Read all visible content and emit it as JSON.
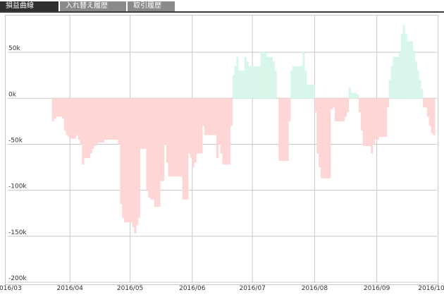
{
  "tabs": [
    {
      "label": "損益曲線",
      "active": true
    },
    {
      "label": "入れ替え履歴",
      "active": false
    },
    {
      "label": "取引履歴",
      "active": false
    }
  ],
  "colors": {
    "positive_fill": "#d8f7ea",
    "negative_fill": "#ffd6d6",
    "grid": "#c8c8c8",
    "tab_active": "#303030",
    "tab_inactive": "#8a8a8a"
  },
  "chart_data": {
    "type": "area",
    "title": "",
    "xlabel": "",
    "ylabel": "",
    "grid": true,
    "x_ticks": [
      "2016/03",
      "2016/04",
      "2016/05",
      "2016/06",
      "2016/07",
      "2016/08",
      "2016/09",
      "2016/10"
    ],
    "y_ticks": [
      {
        "value": 50000,
        "label": "50k"
      },
      {
        "value": 0,
        "label": "0k"
      },
      {
        "value": -50000,
        "label": "-50k"
      },
      {
        "value": -100000,
        "label": "-100k"
      },
      {
        "value": -150000,
        "label": "-150k"
      },
      {
        "value": -200000,
        "label": "-200k"
      }
    ],
    "ylim": [
      -200000,
      90000
    ],
    "xlim": [
      "2016-03-01",
      "2016-10-01"
    ],
    "points": [
      [
        "2016-03-22",
        0
      ],
      [
        "2016-03-23",
        -25000
      ],
      [
        "2016-03-24",
        -22000
      ],
      [
        "2016-03-25",
        -20000
      ],
      [
        "2016-03-28",
        -22000
      ],
      [
        "2016-03-29",
        -35000
      ],
      [
        "2016-03-30",
        -40000
      ],
      [
        "2016-03-31",
        -42000
      ],
      [
        "2016-04-01",
        -44000
      ],
      [
        "2016-04-04",
        -40000
      ],
      [
        "2016-04-05",
        -45000
      ],
      [
        "2016-04-06",
        -50000
      ],
      [
        "2016-04-07",
        -72000
      ],
      [
        "2016-04-08",
        -65000
      ],
      [
        "2016-04-11",
        -60000
      ],
      [
        "2016-04-12",
        -55000
      ],
      [
        "2016-04-13",
        -52000
      ],
      [
        "2016-04-14",
        -50000
      ],
      [
        "2016-04-15",
        -48000
      ],
      [
        "2016-04-18",
        -45000
      ],
      [
        "2016-04-19",
        -45000
      ],
      [
        "2016-04-20",
        -45000
      ],
      [
        "2016-04-21",
        -45000
      ],
      [
        "2016-04-22",
        -45000
      ],
      [
        "2016-04-25",
        -50000
      ],
      [
        "2016-04-26",
        -115000
      ],
      [
        "2016-04-27",
        -130000
      ],
      [
        "2016-04-28",
        -135000
      ],
      [
        "2016-05-02",
        -140000
      ],
      [
        "2016-05-03",
        -147000
      ],
      [
        "2016-05-04",
        -138000
      ],
      [
        "2016-05-05",
        -130000
      ],
      [
        "2016-05-06",
        -55000
      ],
      [
        "2016-05-09",
        -100000
      ],
      [
        "2016-05-10",
        -108000
      ],
      [
        "2016-05-11",
        -110000
      ],
      [
        "2016-05-12",
        -110000
      ],
      [
        "2016-05-13",
        -118000
      ],
      [
        "2016-05-16",
        -90000
      ],
      [
        "2016-05-17",
        -90000
      ],
      [
        "2016-05-18",
        -50000
      ],
      [
        "2016-05-19",
        -70000
      ],
      [
        "2016-05-20",
        -85000
      ],
      [
        "2016-05-23",
        -85000
      ],
      [
        "2016-05-24",
        -85000
      ],
      [
        "2016-05-25",
        -85000
      ],
      [
        "2016-05-26",
        -85000
      ],
      [
        "2016-05-27",
        -110000
      ],
      [
        "2016-05-30",
        -60000
      ],
      [
        "2016-05-31",
        -65000
      ],
      [
        "2016-06-01",
        -75000
      ],
      [
        "2016-06-02",
        -70000
      ],
      [
        "2016-06-03",
        -60000
      ],
      [
        "2016-06-06",
        -30000
      ],
      [
        "2016-06-07",
        -40000
      ],
      [
        "2016-06-08",
        -40000
      ],
      [
        "2016-06-09",
        -40000
      ],
      [
        "2016-06-10",
        -40000
      ],
      [
        "2016-06-13",
        -65000
      ],
      [
        "2016-06-14",
        -50000
      ],
      [
        "2016-06-15",
        -60000
      ],
      [
        "2016-06-16",
        -72000
      ],
      [
        "2016-06-17",
        -72000
      ],
      [
        "2016-06-20",
        -30000
      ],
      [
        "2016-06-21",
        0
      ],
      [
        "2016-06-21",
        25000
      ],
      [
        "2016-06-22",
        35000
      ],
      [
        "2016-06-23",
        45000
      ],
      [
        "2016-06-24",
        30000
      ],
      [
        "2016-06-27",
        45000
      ],
      [
        "2016-06-28",
        40000
      ],
      [
        "2016-06-29",
        35000
      ],
      [
        "2016-06-30",
        35000
      ],
      [
        "2016-07-01",
        35000
      ],
      [
        "2016-07-04",
        35000
      ],
      [
        "2016-07-05",
        50000
      ],
      [
        "2016-07-06",
        50000
      ],
      [
        "2016-07-07",
        50000
      ],
      [
        "2016-07-08",
        45000
      ],
      [
        "2016-07-11",
        40000
      ],
      [
        "2016-07-12",
        30000
      ],
      [
        "2016-07-13",
        0
      ],
      [
        "2016-07-14",
        -68000
      ],
      [
        "2016-07-15",
        -68000
      ],
      [
        "2016-07-18",
        -68000
      ],
      [
        "2016-07-19",
        -25000
      ],
      [
        "2016-07-20",
        0
      ],
      [
        "2016-07-20",
        30000
      ],
      [
        "2016-07-21",
        35000
      ],
      [
        "2016-07-22",
        35000
      ],
      [
        "2016-07-25",
        35000
      ],
      [
        "2016-07-26",
        50000
      ],
      [
        "2016-07-27",
        30000
      ],
      [
        "2016-07-28",
        15000
      ],
      [
        "2016-07-29",
        15000
      ],
      [
        "2016-08-01",
        0
      ],
      [
        "2016-08-01",
        -15000
      ],
      [
        "2016-08-02",
        -60000
      ],
      [
        "2016-08-03",
        -75000
      ],
      [
        "2016-08-04",
        -87000
      ],
      [
        "2016-08-05",
        -87000
      ],
      [
        "2016-08-08",
        -87000
      ],
      [
        "2016-08-09",
        -12000
      ],
      [
        "2016-08-10",
        -10000
      ],
      [
        "2016-08-11",
        -25000
      ],
      [
        "2016-08-12",
        -25000
      ],
      [
        "2016-08-15",
        -25000
      ],
      [
        "2016-08-16",
        -20000
      ],
      [
        "2016-08-17",
        -15000
      ],
      [
        "2016-08-18",
        0
      ],
      [
        "2016-08-18",
        12000
      ],
      [
        "2016-08-19",
        6000
      ],
      [
        "2016-08-22",
        4000
      ],
      [
        "2016-08-23",
        0
      ],
      [
        "2016-08-23",
        -15000
      ],
      [
        "2016-08-24",
        -35000
      ],
      [
        "2016-08-25",
        -52000
      ],
      [
        "2016-08-26",
        -52000
      ],
      [
        "2016-08-29",
        -60000
      ],
      [
        "2016-08-30",
        -50000
      ],
      [
        "2016-08-31",
        -45000
      ],
      [
        "2016-09-01",
        -45000
      ],
      [
        "2016-09-02",
        -42000
      ],
      [
        "2016-09-05",
        -42000
      ],
      [
        "2016-09-06",
        -10000
      ],
      [
        "2016-09-07",
        0
      ],
      [
        "2016-09-07",
        20000
      ],
      [
        "2016-09-08",
        35000
      ],
      [
        "2016-09-09",
        45000
      ],
      [
        "2016-09-12",
        50000
      ],
      [
        "2016-09-13",
        70000
      ],
      [
        "2016-09-14",
        80000
      ],
      [
        "2016-09-15",
        70000
      ],
      [
        "2016-09-16",
        62000
      ],
      [
        "2016-09-19",
        52000
      ],
      [
        "2016-09-20",
        40000
      ],
      [
        "2016-09-21",
        30000
      ],
      [
        "2016-09-22",
        20000
      ],
      [
        "2016-09-23",
        10000
      ],
      [
        "2016-09-24",
        0
      ],
      [
        "2016-09-24",
        -10000
      ],
      [
        "2016-09-26",
        -20000
      ],
      [
        "2016-09-27",
        -30000
      ],
      [
        "2016-09-28",
        -38000
      ],
      [
        "2016-09-29",
        -40000
      ],
      [
        "2016-09-30",
        0
      ]
    ]
  }
}
